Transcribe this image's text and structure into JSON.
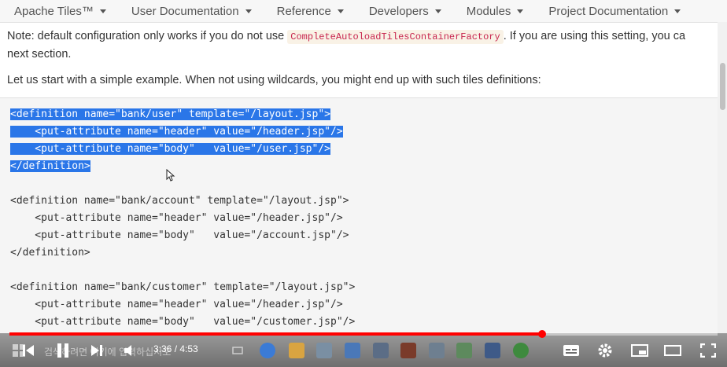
{
  "topnav": {
    "items": [
      {
        "label": "Apache Tiles™"
      },
      {
        "label": "User Documentation"
      },
      {
        "label": "Reference"
      },
      {
        "label": "Developers"
      },
      {
        "label": "Modules"
      },
      {
        "label": "Project Documentation"
      }
    ]
  },
  "content": {
    "note_prefix": "Note: default configuration only works if you do not use ",
    "note_code": "CompleteAutoloadTilesContainerFactory",
    "note_suffix": ". If you are using this setting, you ca",
    "note_line2": "next section.",
    "intro": "Let us start with a simple example. When not using wildcards, you might end up with such tiles definitions:"
  },
  "code_lines": [
    {
      "text": "<definition name=\"bank/user\" template=\"/layout.jsp\">",
      "selected": true
    },
    {
      "text": "    <put-attribute name=\"header\" value=\"/header.jsp\"/>",
      "selected": true
    },
    {
      "text": "    <put-attribute name=\"body\"   value=\"/user.jsp\"/>",
      "selected": true
    },
    {
      "text": "</definition>",
      "selected": true
    },
    {
      "text": "",
      "selected": false
    },
    {
      "text": "<definition name=\"bank/account\" template=\"/layout.jsp\">",
      "selected": false
    },
    {
      "text": "    <put-attribute name=\"header\" value=\"/header.jsp\"/>",
      "selected": false
    },
    {
      "text": "    <put-attribute name=\"body\"   value=\"/account.jsp\"/>",
      "selected": false
    },
    {
      "text": "</definition>",
      "selected": false
    },
    {
      "text": "",
      "selected": false
    },
    {
      "text": "<definition name=\"bank/customer\" template=\"/layout.jsp\">",
      "selected": false
    },
    {
      "text": "    <put-attribute name=\"header\" value=\"/header.jsp\"/>",
      "selected": false
    },
    {
      "text": "    <put-attribute name=\"body\"   value=\"/customer.jsp\"/>",
      "selected": false
    }
  ],
  "player": {
    "current_time": "3:36",
    "duration": "4:53",
    "time_separator": " / ",
    "progress_fraction": 0.7517,
    "hint_text": "검색하려면 여기에 입력하십시오",
    "colors": {
      "progress": "#ff0000",
      "selection": "#2a76e8"
    }
  }
}
